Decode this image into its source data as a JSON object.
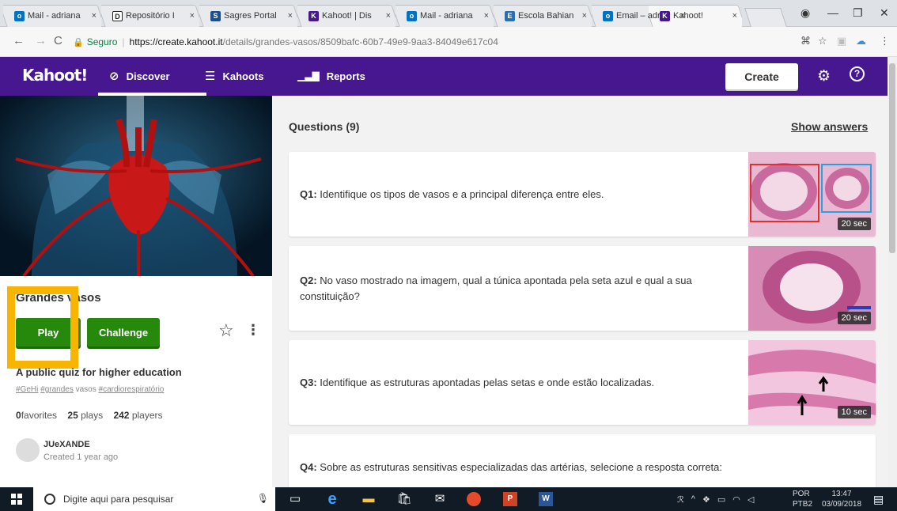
{
  "browser": {
    "tabs": [
      {
        "title": "Mail - adriana",
        "favicon": "outlook-icon",
        "color": "#0072c6"
      },
      {
        "title": "Repositório I",
        "favicon": "d-icon",
        "color": "#222222"
      },
      {
        "title": "Sagres Portal",
        "favicon": "s-icon",
        "color": "#1e4d8c"
      },
      {
        "title": "Kahoot! | Dis",
        "favicon": "kahoot-icon",
        "color": "#46178f"
      },
      {
        "title": "Mail - adriana",
        "favicon": "outlook-icon",
        "color": "#0072c6"
      },
      {
        "title": "Escola Bahian",
        "favicon": "school-icon",
        "color": "#2a6fb0"
      },
      {
        "title": "Email – adria",
        "favicon": "outlook-icon",
        "color": "#0072c6"
      },
      {
        "title": "Kahoot!",
        "favicon": "kahoot-icon",
        "color": "#46178f"
      }
    ],
    "secure_label": "Seguro",
    "url_host": "https://create.kahoot.it",
    "url_path": "/details/grandes-vasos/8509bafc-60b7-49e9-9aa3-84049e617c04"
  },
  "nav": {
    "logo": "Kahoot!",
    "discover": "Discover",
    "kahoots": "Kahoots",
    "reports": "Reports",
    "create": "Create",
    "brand_color": "#46178f"
  },
  "quiz": {
    "title": "Grandes vasos",
    "play": "Play",
    "challenge": "Challenge",
    "description": "A public quiz for higher education",
    "tags": [
      "#GeHi",
      "#grandes",
      "vasos",
      "#cardiorespiratório"
    ],
    "favorites": "0",
    "favorites_label": "favorites",
    "plays": "25",
    "plays_label": "plays",
    "players": "242",
    "players_label": "players",
    "author": "JUeXANDE",
    "created": "Created 1 year ago",
    "play_color": "#26890c"
  },
  "questions": {
    "header": "Questions (9)",
    "show_answers": "Show answers",
    "items": [
      {
        "num": "Q1:",
        "text": "Identifique os tipos de vasos e a principal diferença entre eles.",
        "time": "20 sec"
      },
      {
        "num": "Q2:",
        "text": "No vaso mostrado na imagem, qual a túnica apontada pela seta azul e qual a sua constituição?",
        "time": "20 sec"
      },
      {
        "num": "Q3:",
        "text": "Identifique as estruturas apontadas pelas setas e onde estão localizadas.",
        "time": "10 sec"
      },
      {
        "num": "Q4:",
        "text": "Sobre as estruturas sensitivas especializadas das artérias, selecione a resposta correta:",
        "time": ""
      }
    ]
  },
  "taskbar": {
    "search_placeholder": "Digite aqui para pesquisar",
    "lang_top": "POR",
    "lang_bottom": "PTB2",
    "time": "13:47",
    "date": "03/09/2018"
  }
}
